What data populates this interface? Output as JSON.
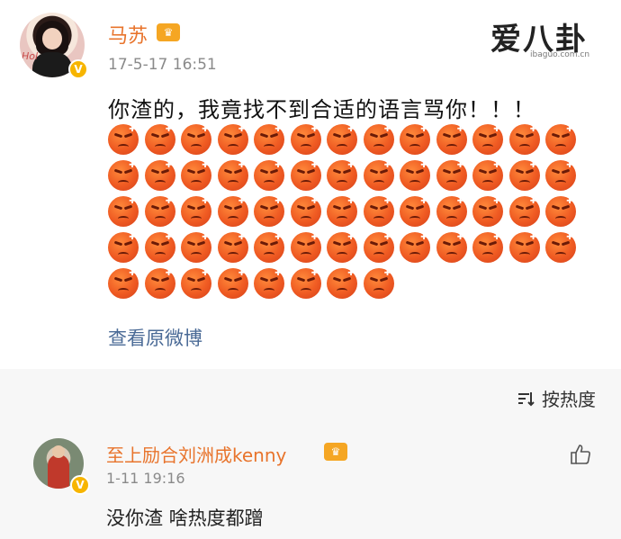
{
  "post": {
    "username": "马苏",
    "timestamp": "17-5-17 16:51",
    "text": "你渣的，我竟找不到合适的语言骂你！！！",
    "emoji_count": 60,
    "emoji_per_row": 13,
    "emoji_name": "angry-face-emoji",
    "view_original": "查看原微博",
    "avatar_text": "Hol"
  },
  "watermark": {
    "main": "爱八卦",
    "sub": "ibaguo.com.cn"
  },
  "sort": {
    "label": "按热度"
  },
  "comment": {
    "username": "至上励合刘洲成kenny",
    "timestamp": "1-11 19:16",
    "text": "没你渣 啥热度都蹭"
  },
  "colors": {
    "username": "#e8742c",
    "link": "#4a6a96",
    "badge": "#f7b500",
    "background_gray": "#f7f7f7"
  }
}
